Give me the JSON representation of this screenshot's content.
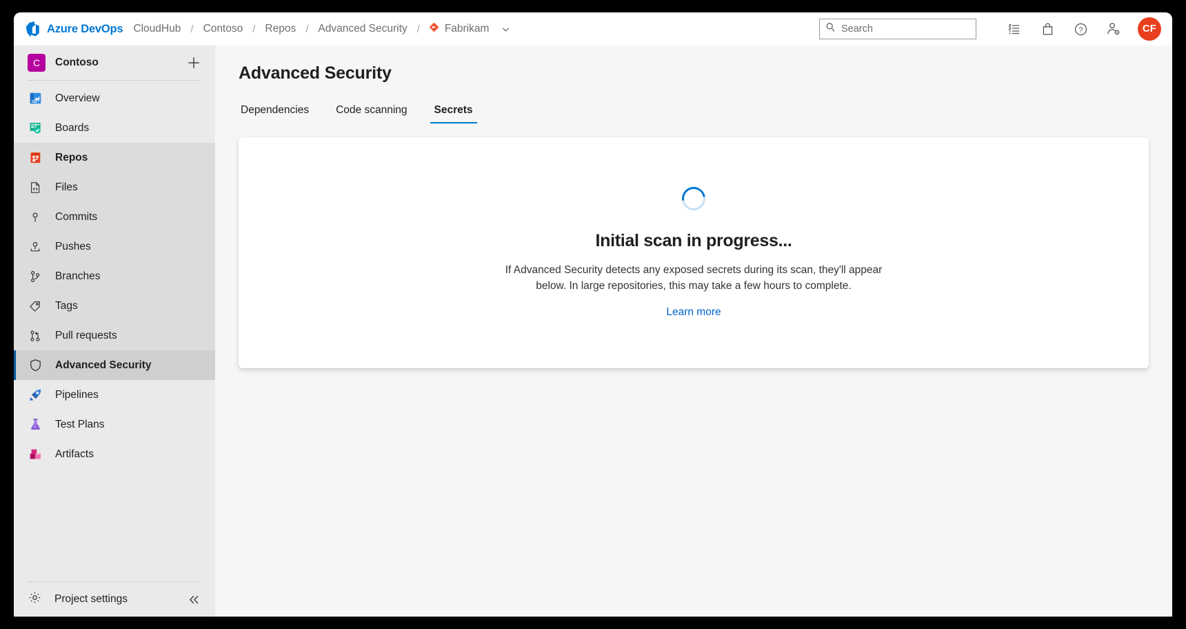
{
  "topbar": {
    "logo_icon": "azure-devops-logo",
    "brand": "Azure DevOps",
    "breadcrumb": [
      {
        "label": "CloudHub"
      },
      {
        "label": "Contoso"
      },
      {
        "label": "Repos"
      },
      {
        "label": "Advanced Security"
      }
    ],
    "separator": "/",
    "repo": {
      "icon": "git-repository-icon",
      "label": "Fabrikam",
      "chevron_icon": "chevron-down-icon"
    },
    "search": {
      "icon": "search-icon",
      "placeholder": "Search",
      "value": ""
    },
    "icons": [
      {
        "name": "backlog-list-icon"
      },
      {
        "name": "marketplace-bag-icon"
      },
      {
        "name": "help-question-icon"
      },
      {
        "name": "user-settings-icon"
      }
    ],
    "avatar": {
      "initials": "CF",
      "color": "#e8401f"
    }
  },
  "sidebar": {
    "project": {
      "badge_letter": "C",
      "badge_color": "#b4009e",
      "name": "Contoso",
      "add_icon": "plus-icon"
    },
    "items": [
      {
        "label": "Overview",
        "icon": "overview-icon",
        "state": "normal"
      },
      {
        "label": "Boards",
        "icon": "boards-icon",
        "state": "normal"
      },
      {
        "label": "Repos",
        "icon": "repos-icon",
        "state": "group-head"
      },
      {
        "label": "Files",
        "icon": "files-icon",
        "state": "sub"
      },
      {
        "label": "Commits",
        "icon": "commits-icon",
        "state": "sub"
      },
      {
        "label": "Pushes",
        "icon": "pushes-icon",
        "state": "sub"
      },
      {
        "label": "Branches",
        "icon": "branches-icon",
        "state": "sub"
      },
      {
        "label": "Tags",
        "icon": "tags-icon",
        "state": "sub"
      },
      {
        "label": "Pull requests",
        "icon": "pull-requests-icon",
        "state": "sub"
      },
      {
        "label": "Advanced Security",
        "icon": "shield-icon",
        "state": "selected"
      },
      {
        "label": "Pipelines",
        "icon": "pipelines-icon",
        "state": "normal"
      },
      {
        "label": "Test Plans",
        "icon": "test-plans-icon",
        "state": "normal"
      },
      {
        "label": "Artifacts",
        "icon": "artifacts-icon",
        "state": "normal"
      }
    ],
    "footer": {
      "icon": "gear-icon",
      "label": "Project settings",
      "collapse_icon": "double-chevron-left-icon"
    }
  },
  "main": {
    "title": "Advanced Security",
    "tabs": [
      {
        "label": "Dependencies",
        "active": false
      },
      {
        "label": "Code scanning",
        "active": false
      },
      {
        "label": "Secrets",
        "active": true
      }
    ],
    "empty_state": {
      "spinner_icon": "loading-spinner-icon",
      "title": "Initial scan in progress...",
      "description": "If Advanced Security detects any exposed secrets during its scan, they'll appear below. In large repositories, this may take a few hours to complete.",
      "link_label": "Learn more"
    }
  },
  "colors": {
    "accent": "#0078d4",
    "link": "#0066cc",
    "selected_bar": "#005a9e",
    "sidebar_bg": "#eaeaea",
    "content_bg": "#f6f6f6"
  }
}
